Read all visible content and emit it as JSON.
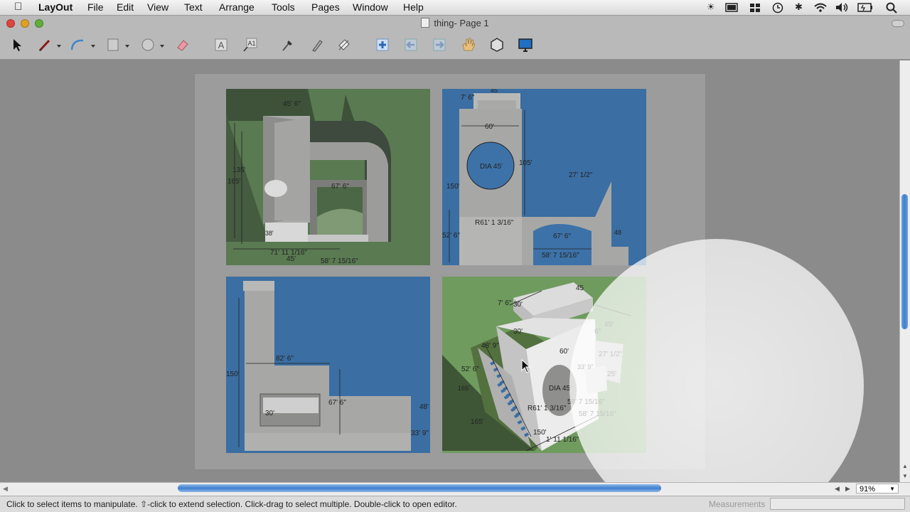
{
  "menubar": {
    "app_name": "LayOut",
    "items": [
      "File",
      "Edit",
      "View",
      "Text",
      "Arrange",
      "Tools",
      "Pages",
      "Window",
      "Help"
    ],
    "tray_icons": [
      "brightness-icon",
      "display-icon",
      "spaces-icon",
      "time-machine-icon",
      "bluetooth-icon",
      "wifi-icon",
      "volume-icon",
      "battery-icon",
      "spotlight-icon"
    ]
  },
  "window": {
    "title": "thing- Page 1"
  },
  "toolbar": {
    "tools": [
      "select-tool-icon",
      "line-tool-icon",
      "arc-tool-icon",
      "rectangle-tool-icon",
      "circle-tool-icon",
      "eraser-tool-icon",
      "text-tool-icon",
      "label-tool-icon",
      "sample-style-icon",
      "apply-style-icon",
      "dimension-tool-icon",
      "add-page-icon",
      "previous-page-icon",
      "next-page-icon",
      "pan-tool-icon",
      "split-tool-icon",
      "presentation-icon"
    ]
  },
  "drawing": {
    "tl_labels": [
      "45' 6\"",
      "135'",
      "165'",
      "67' 6\"",
      "38'",
      "71' 11 1/16\"",
      "45'",
      "58' 7 15/16\""
    ],
    "tr_labels": [
      "7' 6\"",
      "45",
      "60'",
      "DIA 45'",
      "105'",
      "27' 1/2\"",
      "150'",
      "52' 6\"",
      "R61' 1 3/16\"",
      "67' 6\"",
      "58' 7 15/16\"",
      "48"
    ],
    "bl_labels": [
      "82' 6\"",
      "150'",
      "30'",
      "67' 6\"",
      "48'",
      "33' 9\""
    ],
    "br_labels": [
      "45",
      "7' 6\"",
      "30'",
      "30'",
      "6\"",
      "45'",
      "60'",
      "27' 1/2\"",
      "48' 9\"",
      "52' 6\"",
      "165'",
      "DIA 45'",
      "R61' 1 3/16\"",
      "58' 7 15/16\"",
      "58' 7 15/16\"",
      "150'",
      "1' 11 1/16\"",
      "165'",
      "25'",
      "33' 9\""
    ]
  },
  "zoom": "91%",
  "status": {
    "message": "Click to select items to manipulate. ⇧-click to extend selection. Click-drag to select multiple. Double-click to open editor.",
    "measurements_label": "Measurements"
  }
}
